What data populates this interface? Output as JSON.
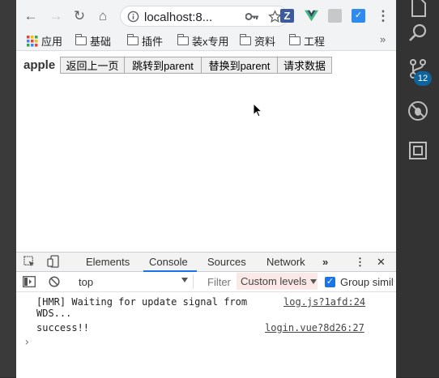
{
  "browser": {
    "url": "localhost:8...",
    "nav": {
      "back": "←",
      "forward": "→",
      "reload": "↻",
      "home": "⌂"
    },
    "toolbar_icons": {
      "key": "key-icon",
      "star": "star-icon",
      "menu": "⋮"
    },
    "extensions": [
      {
        "name": "z-extension-icon",
        "letter": "Z",
        "color": "#3d5a9c"
      },
      {
        "name": "vue-devtools-icon",
        "letter": "V",
        "color": "#41b883"
      },
      {
        "name": "extension-gray-icon",
        "letter": "",
        "color": "#b8b8b8"
      },
      {
        "name": "extension-blue-icon",
        "letter": "✓",
        "color": "#2f8bf0"
      }
    ]
  },
  "bookmarks": {
    "apps": "应用",
    "items": [
      "基础",
      "插件",
      "装x专用",
      "资料",
      "工程"
    ],
    "more": "»"
  },
  "page": {
    "title": "apple",
    "buttons": [
      "返回上一页",
      "跳转到parent",
      "替换到parent",
      "请求数据"
    ]
  },
  "devtools": {
    "tabs": [
      "Elements",
      "Console",
      "Sources",
      "Network"
    ],
    "active_tab": "Console",
    "more_tabs": "»",
    "menu": "⋮",
    "close": "✕",
    "context": "top",
    "filter_placeholder": "Filter",
    "levels": "Custom levels",
    "group_similar": "Group simil",
    "messages": [
      {
        "text_line1": "[HMR] Waiting for update signal from",
        "text_line2": "WDS...",
        "source": "log.js?1afd:24"
      },
      {
        "text_line1": "success!!",
        "text_line2": "",
        "source": "login.vue?8d26:27"
      }
    ],
    "prompt": "›"
  },
  "right_bar": {
    "badge": "12"
  }
}
